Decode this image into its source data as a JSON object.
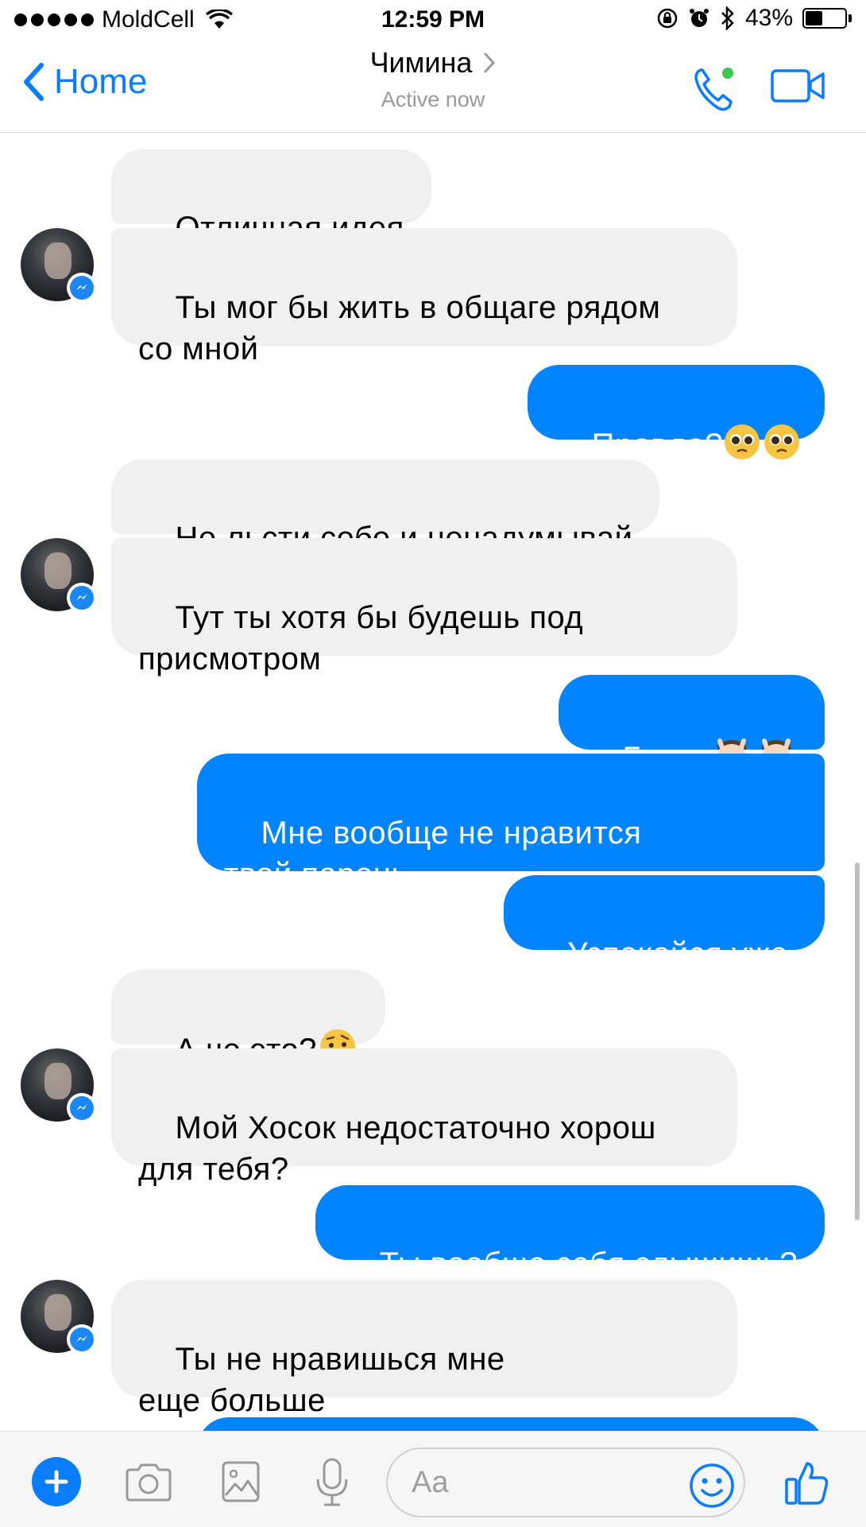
{
  "status_bar": {
    "carrier": "MoldCell",
    "time": "12:59 PM",
    "battery_text": "43%",
    "battery_level": 0.43
  },
  "nav": {
    "back_label": "Home",
    "title": "Чимина",
    "subtitle": "Active now",
    "accent_color": "#0a7cff",
    "online_color": "#3cc74f"
  },
  "messages": [
    {
      "dir": "in",
      "text": "Отличная идея"
    },
    {
      "dir": "in",
      "text": "Ты мог бы жить в общаге рядом\nсо мной"
    },
    {
      "dir": "out",
      "text": "Правда?",
      "emoji": "pleading-face x2"
    },
    {
      "dir": "in",
      "text": "Не льсти себе и ненадумывай"
    },
    {
      "dir": "in",
      "text": "Тут ты хотя бы будешь под\nприсмотром"
    },
    {
      "dir": "out",
      "text": "Боже ",
      "emoji": "face-massage x2"
    },
    {
      "dir": "out",
      "text": "Мне вообще не нравится\nтвой парень"
    },
    {
      "dir": "out",
      "text": "Успокойся уже"
    },
    {
      "dir": "in",
      "text": "А че это?",
      "emoji": "raised-eyebrow-face"
    },
    {
      "dir": "in",
      "text": "Мой Хосок недостаточно хорош\nдля тебя?"
    },
    {
      "dir": "out",
      "text": "Ты вообще себя слышишь?"
    },
    {
      "dir": "in",
      "text": "Ты не нравишься мне\nеще больше"
    }
  ],
  "composer": {
    "placeholder": "Aa",
    "icons": [
      "plus-icon",
      "camera-icon",
      "gallery-icon",
      "microphone-icon",
      "smiley-icon",
      "thumbs-up-icon"
    ]
  },
  "colors": {
    "outgoing_bubble": "#0084ff",
    "incoming_bubble": "#f1f0f0"
  }
}
